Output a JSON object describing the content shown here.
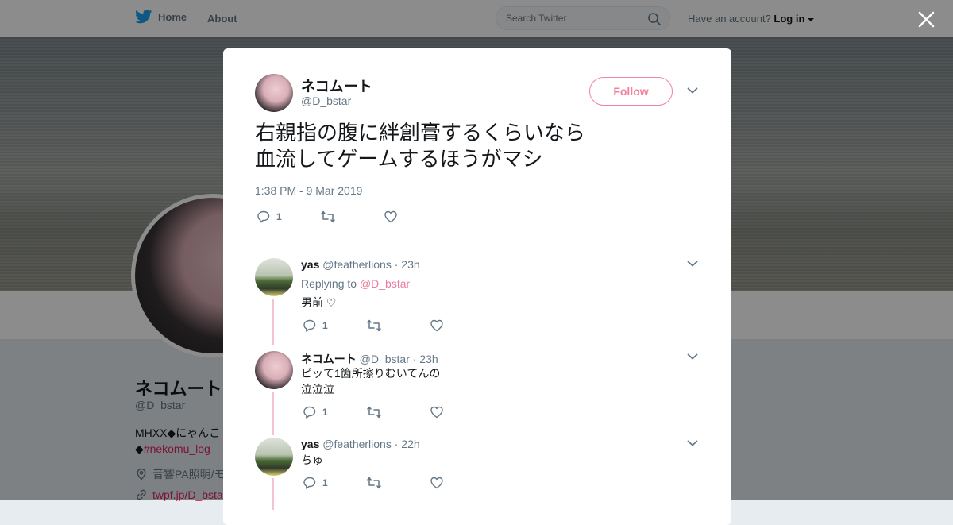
{
  "header": {
    "home_label": "Home",
    "about_label": "About",
    "search_placeholder": "Search Twitter",
    "have_account": "Have an account?",
    "login_label": "Log in"
  },
  "profile": {
    "name": "ネコムート",
    "handle": "@D_bstar",
    "bio_line1": "MHXX◆にゃんこ",
    "bio_line2_prefix": "◆",
    "bio_hashtag": "#nekomu_log",
    "location": "音響PA照明/モ",
    "url": "twpf.jp/D_bsta"
  },
  "tweet": {
    "author_name": "ネコムート",
    "author_handle": "@D_bstar",
    "follow_label": "Follow",
    "text": "右親指の腹に絆創膏するくらいなら\n血流してゲームするほうがマシ",
    "timestamp": "1:38 PM - 9 Mar 2019",
    "reply_count": "1"
  },
  "replies": [
    {
      "name": "yas",
      "handle": "@featherlions",
      "time": "· 23h",
      "replying_to_label": "Replying to",
      "replying_to": "@D_bstar",
      "text": "男前 ♡",
      "reply_count": "1"
    },
    {
      "name": "ネコムート",
      "handle": "@D_bstar",
      "time": "· 23h",
      "text": "ピッて1箇所擦りむいてんの\n泣泣泣",
      "reply_count": "1"
    },
    {
      "name": "yas",
      "handle": "@featherlions",
      "time": "· 22h",
      "text": "ちゅ",
      "reply_count": "1"
    }
  ],
  "colors": {
    "brand_blue": "#1da1f2",
    "accent_pink": "#e81c4f",
    "thread_line": "#f4c3cf",
    "secondary_text": "#657786"
  }
}
